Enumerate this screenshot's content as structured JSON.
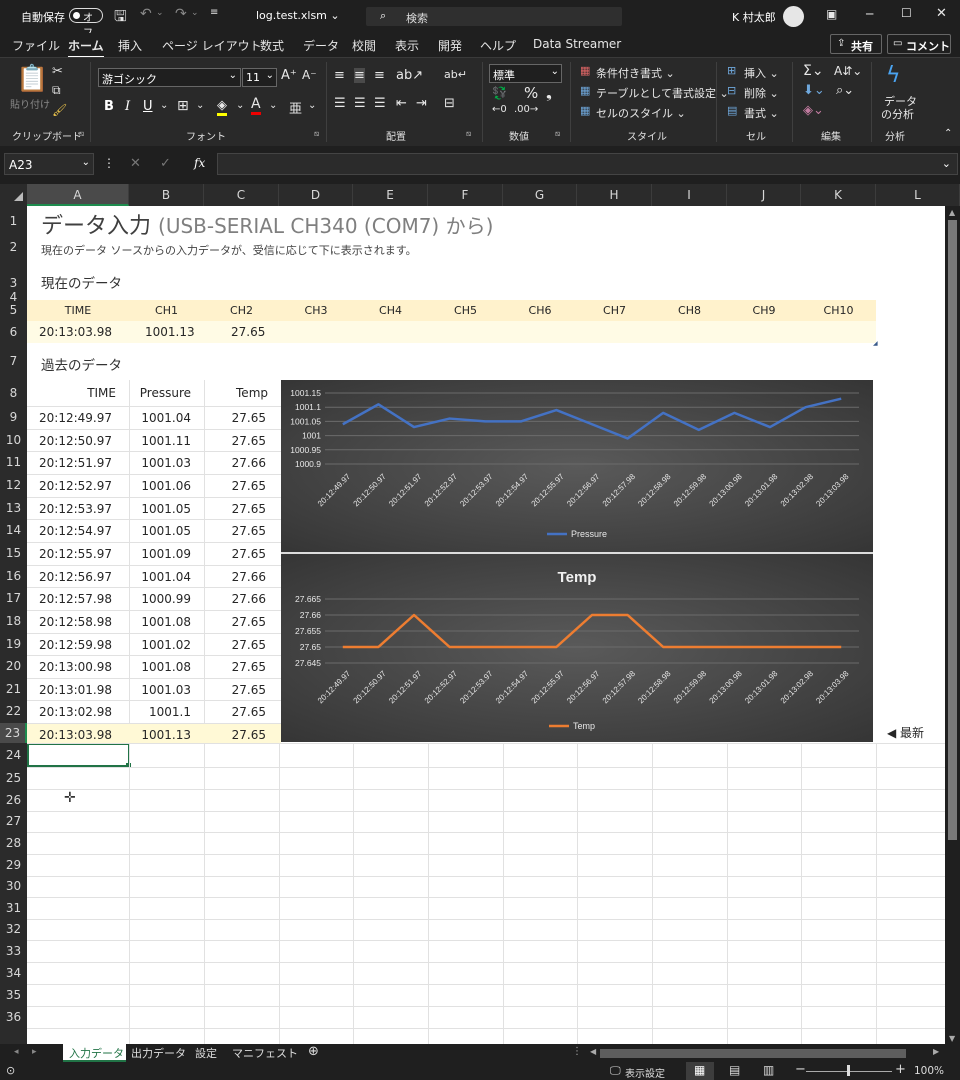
{
  "titlebar": {
    "autosave_label": "自動保存",
    "autosave_state": "オフ",
    "filename": "log.test.xlsm ⌄",
    "search_placeholder": "検索",
    "user": "K 村太郎"
  },
  "menu_tabs": [
    {
      "label": "ファイル"
    },
    {
      "label": "ホーム"
    },
    {
      "label": "挿入"
    },
    {
      "label": "ページ レイアウト"
    },
    {
      "label": "数式"
    },
    {
      "label": "データ"
    },
    {
      "label": "校閲"
    },
    {
      "label": "表示"
    },
    {
      "label": "開発"
    },
    {
      "label": "ヘルプ"
    },
    {
      "label": "Data Streamer"
    }
  ],
  "share": {
    "share_label": "共有",
    "comment_label": "コメント"
  },
  "ribbon": {
    "clipboard": {
      "paste": "貼り付け",
      "label": "クリップボード"
    },
    "font": {
      "name": "游ゴシック",
      "size": "11",
      "label": "フォント",
      "bold": "B",
      "italic": "I",
      "underline": "U"
    },
    "alignment": {
      "label": "配置"
    },
    "number": {
      "format": "標準",
      "label": "数値"
    },
    "styles": {
      "cond": "条件付き書式 ⌄",
      "table": "テーブルとして書式設定 ⌄",
      "cell": "セルのスタイル ⌄",
      "label": "スタイル"
    },
    "cells": {
      "insert": "挿入 ⌄",
      "delete": "削除 ⌄",
      "format": "書式 ⌄",
      "label": "セル"
    },
    "edit": {
      "label": "編集"
    },
    "analysis": {
      "btn1": "データ",
      "btn2": "の分析",
      "label": "分析"
    }
  },
  "formula": {
    "namebox": "A23",
    "fx": "fx"
  },
  "columns": [
    "A",
    "B",
    "C",
    "D",
    "E",
    "F",
    "G",
    "H",
    "I",
    "J",
    "K",
    "L"
  ],
  "rows": [
    "1",
    "2",
    "3",
    "4",
    "5",
    "6",
    "7",
    "8",
    "9",
    "10",
    "11",
    "12",
    "13",
    "14",
    "15",
    "16",
    "17",
    "18",
    "19",
    "20",
    "21",
    "22",
    "23",
    "24",
    "25",
    "26",
    "27",
    "28",
    "29",
    "30",
    "31",
    "32",
    "33",
    "34",
    "35",
    "36"
  ],
  "sheet": {
    "title": "データ入力",
    "title_suffix": "(USB-SERIAL CH340 (COM7) から)",
    "subtitle": "現在のデータ ソースからの入力データが、受信に応じて下に表示されます。",
    "current_heading": "現在のデータ",
    "current_headers": [
      "TIME",
      "CH1",
      "CH2",
      "CH3",
      "CH4",
      "CH5",
      "CH6",
      "CH7",
      "CH8",
      "CH9",
      "CH10"
    ],
    "current_values": [
      "20:13:03.98",
      "1001.13",
      "27.65"
    ],
    "history_heading": "過去のデータ",
    "history_headers": [
      "TIME",
      "Pressure",
      "Temp"
    ],
    "history_rows": [
      [
        "20:12:49.97",
        "1001.04",
        "27.65"
      ],
      [
        "20:12:50.97",
        "1001.11",
        "27.65"
      ],
      [
        "20:12:51.97",
        "1001.03",
        "27.66"
      ],
      [
        "20:12:52.97",
        "1001.06",
        "27.65"
      ],
      [
        "20:12:53.97",
        "1001.05",
        "27.65"
      ],
      [
        "20:12:54.97",
        "1001.05",
        "27.65"
      ],
      [
        "20:12:55.97",
        "1001.09",
        "27.65"
      ],
      [
        "20:12:56.97",
        "1001.04",
        "27.66"
      ],
      [
        "20:12:57.98",
        "1000.99",
        "27.66"
      ],
      [
        "20:12:58.98",
        "1001.08",
        "27.65"
      ],
      [
        "20:12:59.98",
        "1001.02",
        "27.65"
      ],
      [
        "20:13:00.98",
        "1001.08",
        "27.65"
      ],
      [
        "20:13:01.98",
        "1001.03",
        "27.65"
      ],
      [
        "20:13:02.98",
        "1001.1",
        "27.65"
      ],
      [
        "20:13:03.98",
        "1001.13",
        "27.65"
      ]
    ],
    "latest_label": "◀ 最新"
  },
  "chart_data": [
    {
      "type": "line",
      "title": "",
      "x": [
        "20:12:49.97",
        "20:12:50.97",
        "20:12:51.97",
        "20:12:52.97",
        "20:12:53.97",
        "20:12:54.97",
        "20:12:55.97",
        "20:12:56.97",
        "20:12:57.98",
        "20:12:58.98",
        "20:12:59.98",
        "20:13:00.98",
        "20:13:01.98",
        "20:13:02.98",
        "20:13:03.98"
      ],
      "series": [
        {
          "name": "Pressure",
          "values": [
            1001.04,
            1001.11,
            1001.03,
            1001.06,
            1001.05,
            1001.05,
            1001.09,
            1001.04,
            1000.99,
            1001.08,
            1001.02,
            1001.08,
            1001.03,
            1001.1,
            1001.13
          ],
          "color": "#4472c4"
        }
      ],
      "yticks": [
        "1001.15",
        "1001.1",
        "1001.05",
        "1001",
        "1000.95",
        "1000.9"
      ],
      "ylim": [
        1000.9,
        1001.15
      ],
      "legend": "bottom",
      "grid": true
    },
    {
      "type": "line",
      "title": "Temp",
      "x": [
        "20:12:49.97",
        "20:12:50.97",
        "20:12:51.97",
        "20:12:52.97",
        "20:12:53.97",
        "20:12:54.97",
        "20:12:55.97",
        "20:12:56.97",
        "20:12:57.98",
        "20:12:58.98",
        "20:12:59.98",
        "20:13:00.98",
        "20:13:01.98",
        "20:13:02.98",
        "20:13:03.98"
      ],
      "series": [
        {
          "name": "Temp",
          "values": [
            27.65,
            27.65,
            27.66,
            27.65,
            27.65,
            27.65,
            27.65,
            27.66,
            27.66,
            27.65,
            27.65,
            27.65,
            27.65,
            27.65,
            27.65
          ],
          "color": "#ed7d31"
        }
      ],
      "yticks": [
        "27.665",
        "27.66",
        "27.655",
        "27.65",
        "27.645"
      ],
      "ylim": [
        27.645,
        27.665
      ],
      "legend": "bottom",
      "grid": true
    }
  ],
  "sheettabs": [
    {
      "label": "入力データ"
    },
    {
      "label": "出力データ"
    },
    {
      "label": "設定"
    },
    {
      "label": "マニフェスト"
    }
  ],
  "status": {
    "display_settings": "表示設定",
    "zoom": "100%"
  }
}
